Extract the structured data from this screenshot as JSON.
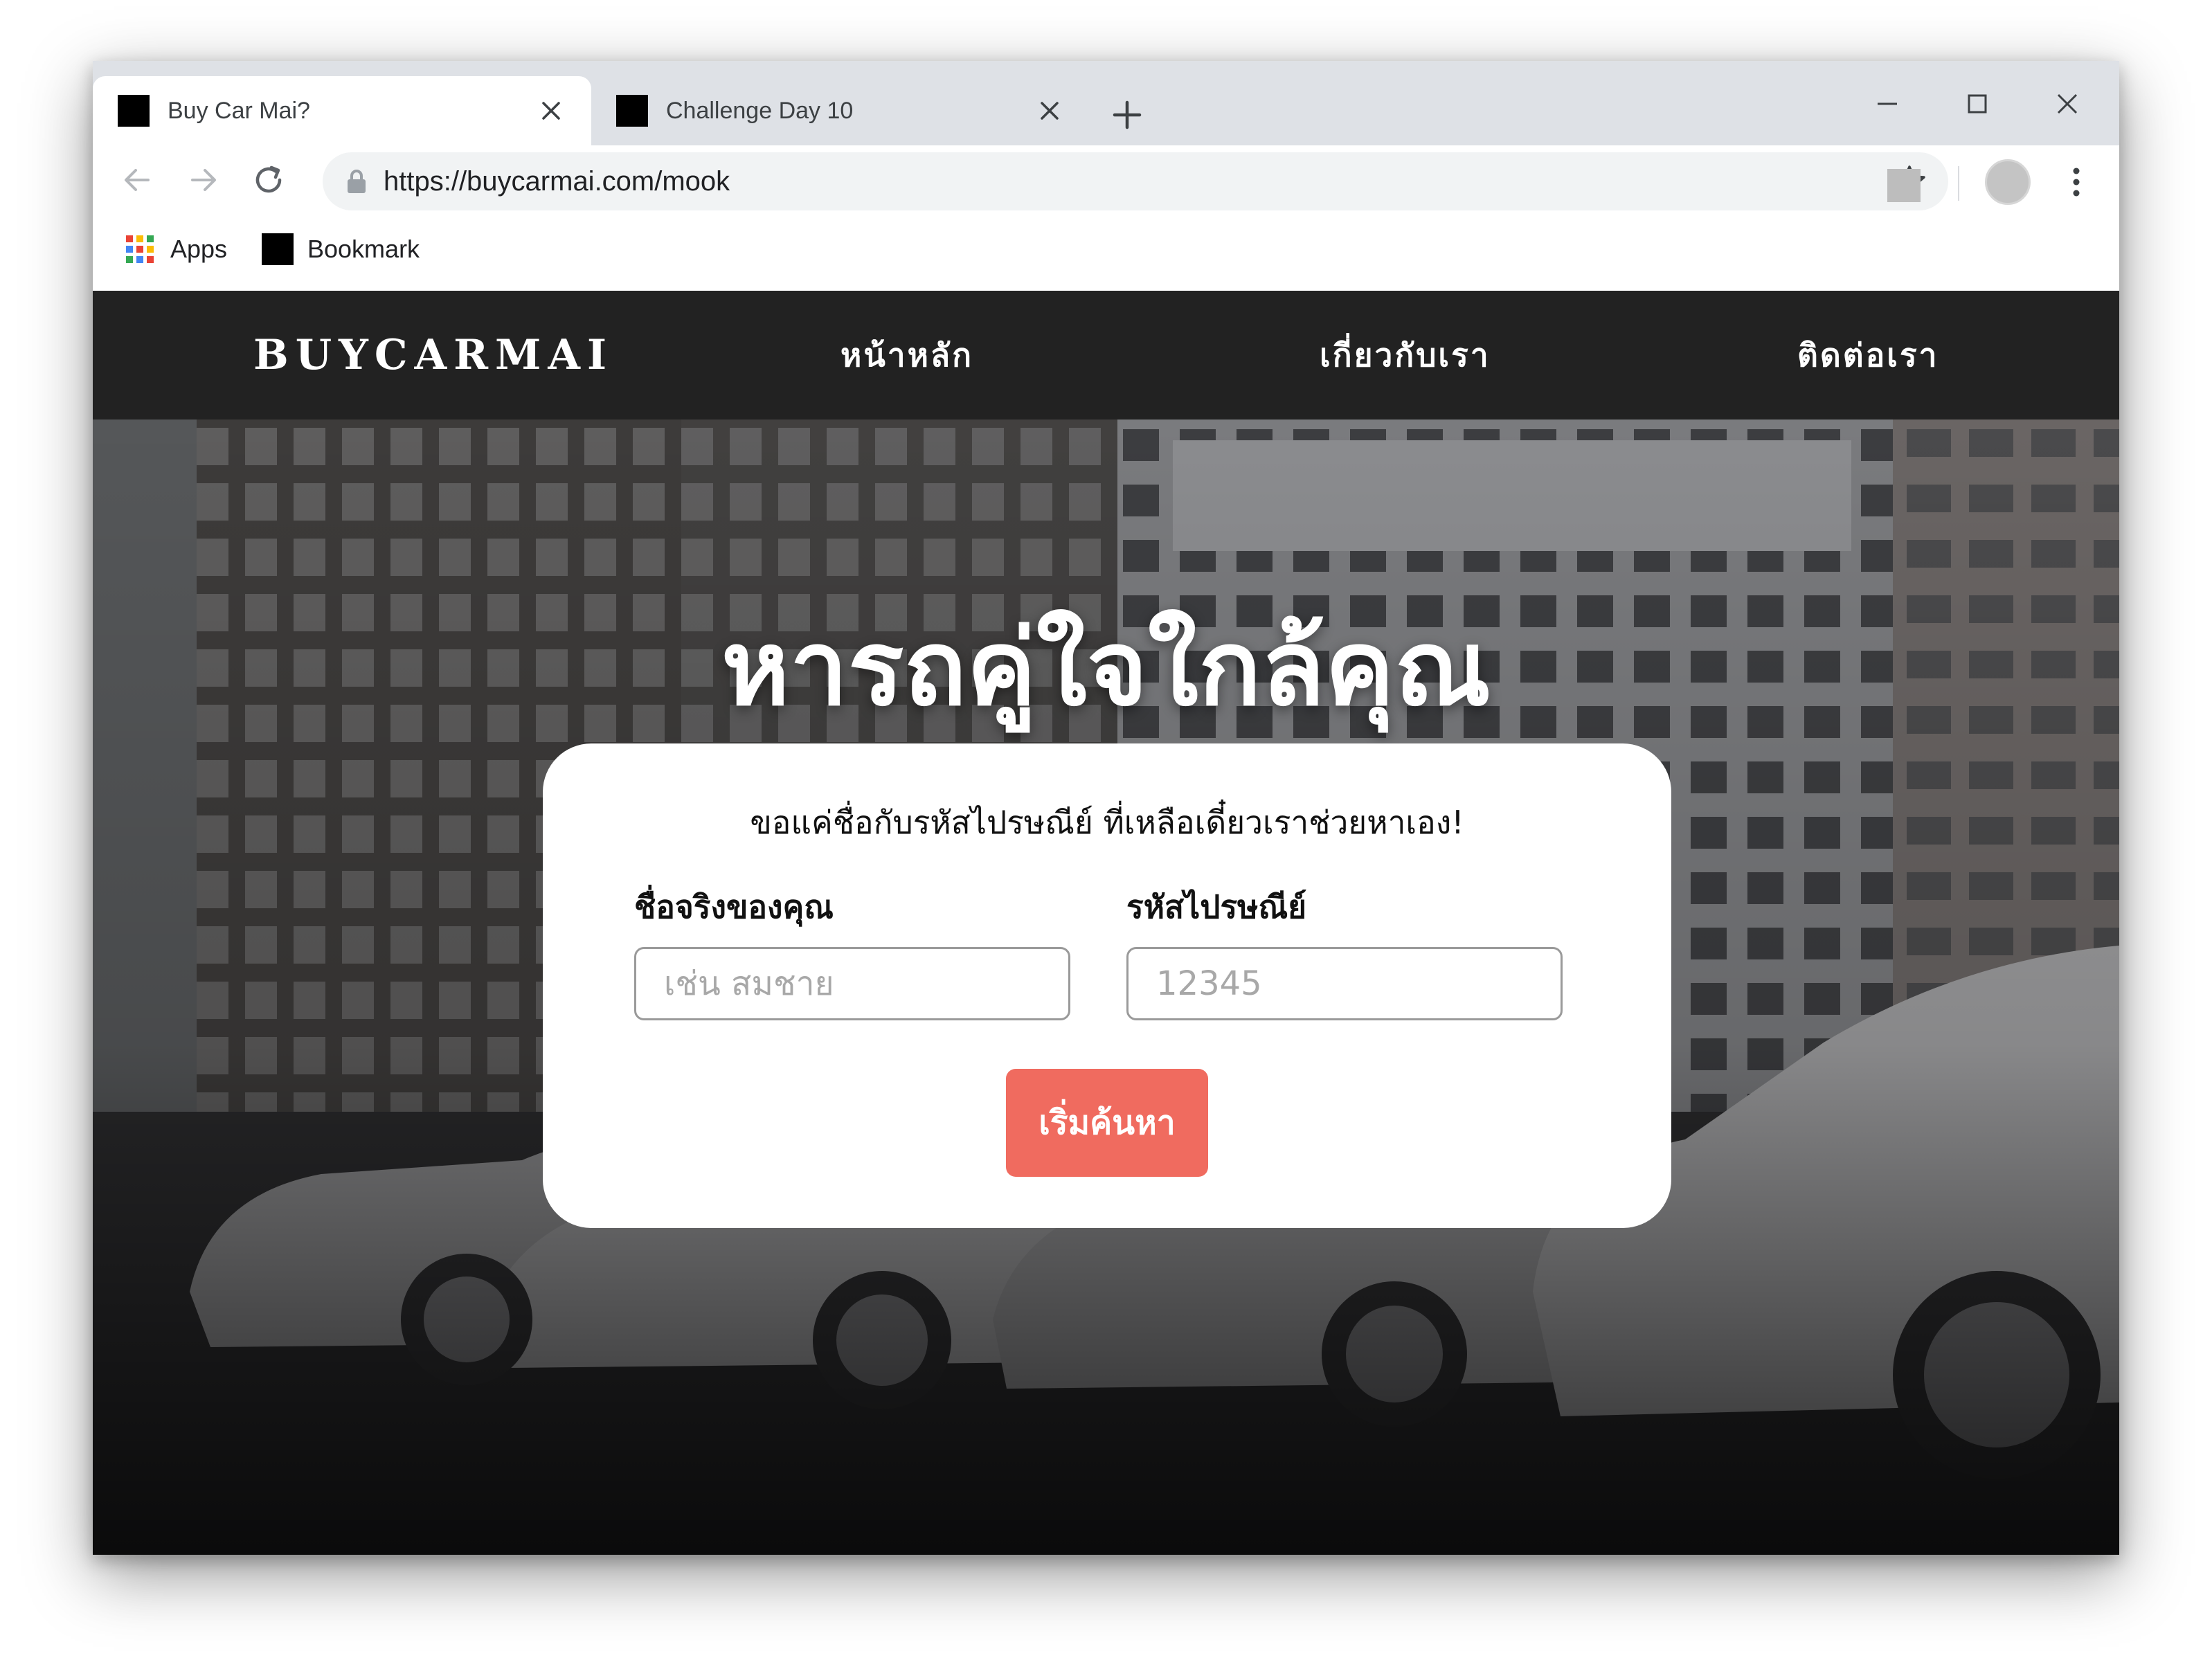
{
  "browser": {
    "tabs": [
      {
        "title": "Buy Car Mai?",
        "active": true
      },
      {
        "title": "Challenge Day 10",
        "active": false
      }
    ],
    "url": "https://buycarmai.com/mook",
    "bookmarks": [
      {
        "label": "Apps",
        "icon": "apps-grid-icon"
      },
      {
        "label": "Bookmark",
        "icon": "bookmark-favicon"
      }
    ]
  },
  "site": {
    "logo": "BUYCARMAI",
    "nav": [
      "หน้าหลัก",
      "เกี่ยวกับเรา",
      "ติดต่อเรา"
    ]
  },
  "hero": {
    "title": "หารถคู่ใจใกล้คุณ"
  },
  "form": {
    "subtitle": "ขอแค่ชื่อกับรหัสไปรษณีย์ ที่เหลือเดี๋ยวเราช่วยหาเอง!",
    "name_label": "ชื่อจริงของคุณ",
    "name_placeholder": "เช่น สมชาย",
    "zip_label": "รหัสไปรษณีย์",
    "zip_placeholder": "12345",
    "submit_label": "เริ่มค้นหา"
  },
  "colors": {
    "navbar": "#222222",
    "button": "#f06b5f",
    "card": "#ffffff"
  }
}
